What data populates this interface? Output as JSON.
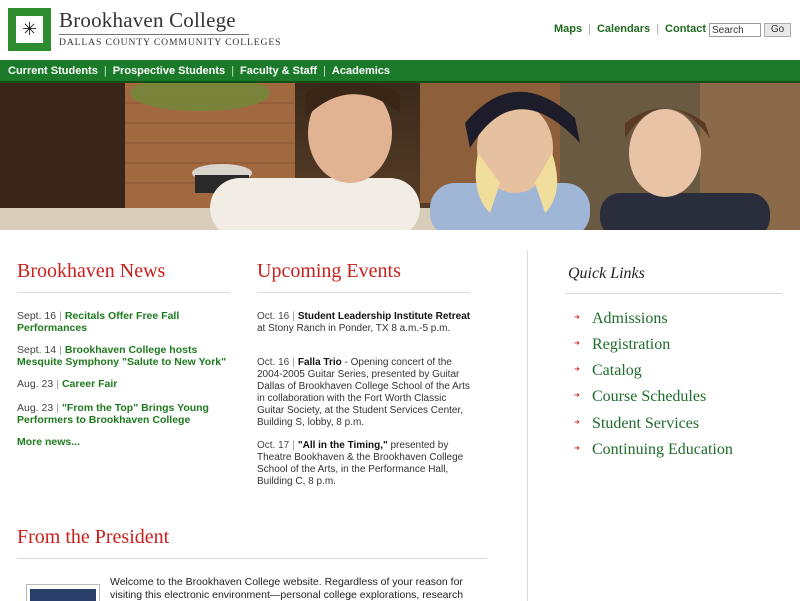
{
  "header": {
    "college_name": "Brookhaven College",
    "college_sub": "DALLAS COUNTY COMMUNITY COLLEGES",
    "util_links": [
      "Maps",
      "Calendars",
      "Contact"
    ],
    "search_value": "Search",
    "go_label": "Go"
  },
  "main_nav": {
    "items": [
      "Current Students",
      "Prospective Students",
      "Faculty & Staff",
      "Academics"
    ]
  },
  "news": {
    "heading": "Brookhaven News",
    "items": [
      {
        "date": "Sept. 16",
        "title": "Recitals Offer Free Fall Performances"
      },
      {
        "date": "Sept. 14",
        "title": "Brookhaven College hosts Mesquite Symphony \"Salute to New York\""
      },
      {
        "date": "Aug. 23",
        "title": "Career Fair"
      },
      {
        "date": "Aug. 23",
        "title": "\"From the Top\" Brings Young Performers to Brookhaven College"
      }
    ],
    "more_label": "More news..."
  },
  "events": {
    "heading": "Upcoming Events",
    "items": [
      {
        "date": "Oct. 16",
        "title": "Student Leadership Institute Retreat",
        "desc": " at Stony Ranch in Ponder, TX 8 a.m.-5 p.m."
      },
      {
        "date": "Oct. 16",
        "title": "Falla Trio",
        "desc": " - Opening concert of the 2004-2005 Guitar Series, presented by Guitar Dallas of Brookhaven College School of the Arts in collaboration with the Fort Worth Classic Guitar Society, at the Student Services Center, Building S, lobby, 8 p.m."
      },
      {
        "date": "Oct. 17",
        "title": "\"All in the Timing,\"",
        "desc": " presented by Theatre Bookhaven & the Brookhaven College School of the Arts, in the Performance Hall, Building C, 8 p.m."
      }
    ]
  },
  "quick_links": {
    "heading": "Quick Links",
    "items": [
      "Admissions",
      "Registration",
      "Catalog",
      "Course Schedules",
      "Student Services",
      "Continuing Education"
    ]
  },
  "president": {
    "heading": "From the President",
    "text": "Welcome to the Brookhaven College website. Regardless of your reason for visiting this electronic environment—personal college explorations, research about"
  },
  "colors": {
    "nav_green": "#1b7a2a",
    "link_green": "#1e7a1e",
    "heading_red": "#c8201d"
  },
  "icons": {
    "logo": "bird-logo-icon",
    "quick_link_bullet": "arrow-right-icon"
  }
}
